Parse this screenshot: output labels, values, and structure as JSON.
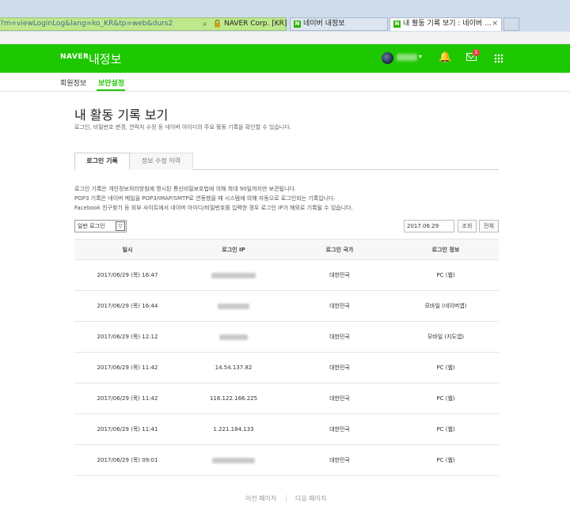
{
  "browser": {
    "url": "?m=viewLoginLog&lang=ko_KR&tp=web&durs2",
    "site_label": "NAVER Corp. [KR]",
    "tabs": [
      {
        "label": "네이버 내정보",
        "active": false
      },
      {
        "label": "내 활동 기록 보기 : 네이버 ...",
        "active": true
      }
    ],
    "tab_close": "×",
    "tab_favicon": "N"
  },
  "header": {
    "logo": "NAVER",
    "title": "내정보",
    "mail_badge": "5",
    "caret": "▾",
    "bell_icon": "🔔",
    "brand_color": "#1ec800"
  },
  "subnav": {
    "items": [
      "회원정보",
      "보안설정"
    ],
    "active_index": 1
  },
  "page": {
    "title": "내 활동 기록 보기",
    "description": "로그인, 비밀번호 변경, 연락처 수정 등 네이버 아이디의 주요 활동 기록을 확인할 수 있습니다."
  },
  "tabs": [
    {
      "label": "로그인 기록",
      "active": true
    },
    {
      "label": "정보 수정 이력",
      "active": false
    }
  ],
  "notes": [
    "로그인 기록은 개인정보처리방침에 명시된 통신비밀보호법에 의해 최대 90일까지만 보관됩니다.",
    "POP3 기록은 네이버 메일을 POP3/IMAP/SMTP로 연동했을 때 시스템에 의해 자동으로 로그인되는 기록입니다.",
    "Facebook 친구찾기 등 외부 사이트에서 네이버 아이디/비밀번호를 입력한 경우 로그인 IP가 해외로 기록될 수 있습니다."
  ],
  "filter": {
    "selected": "일반 로그인",
    "arrow": "▽",
    "date_value": "2017.06.29",
    "search_label": "조회",
    "reset_label": "전체"
  },
  "table": {
    "headers": [
      "일시",
      "로그인 IP",
      "로그인 국가",
      "로그인 정보"
    ],
    "rows": [
      {
        "datetime": "2017/06/29 (목) 16:47",
        "ip": "",
        "ip_blurred": true,
        "country": "대한민국",
        "info": "PC (웹)"
      },
      {
        "datetime": "2017/06/29 (목) 16:44",
        "ip": "",
        "ip_blurred": true,
        "country": "대한민국",
        "info": "모바일 (네이버앱)"
      },
      {
        "datetime": "2017/06/29 (목) 12:12",
        "ip": "",
        "ip_blurred": true,
        "country": "대한민국",
        "info": "모바일 (지도앱)"
      },
      {
        "datetime": "2017/06/29 (목) 11:42",
        "ip": "14.54.137.82",
        "ip_blurred": false,
        "country": "대한민국",
        "info": "PC (웹)"
      },
      {
        "datetime": "2017/06/29 (목) 11:42",
        "ip": "116.122.166.225",
        "ip_blurred": false,
        "country": "대한민국",
        "info": "PC (웹)"
      },
      {
        "datetime": "2017/06/29 (목) 11:41",
        "ip": "1.221.184.133",
        "ip_blurred": false,
        "country": "대한민국",
        "info": "PC (웹)"
      },
      {
        "datetime": "2017/06/29 (목) 09:01",
        "ip": "",
        "ip_blurred": true,
        "country": "대한민국",
        "info": "PC (웹)"
      }
    ]
  },
  "pager": {
    "prev": "이전 페이지",
    "next": "다음 페이지"
  }
}
